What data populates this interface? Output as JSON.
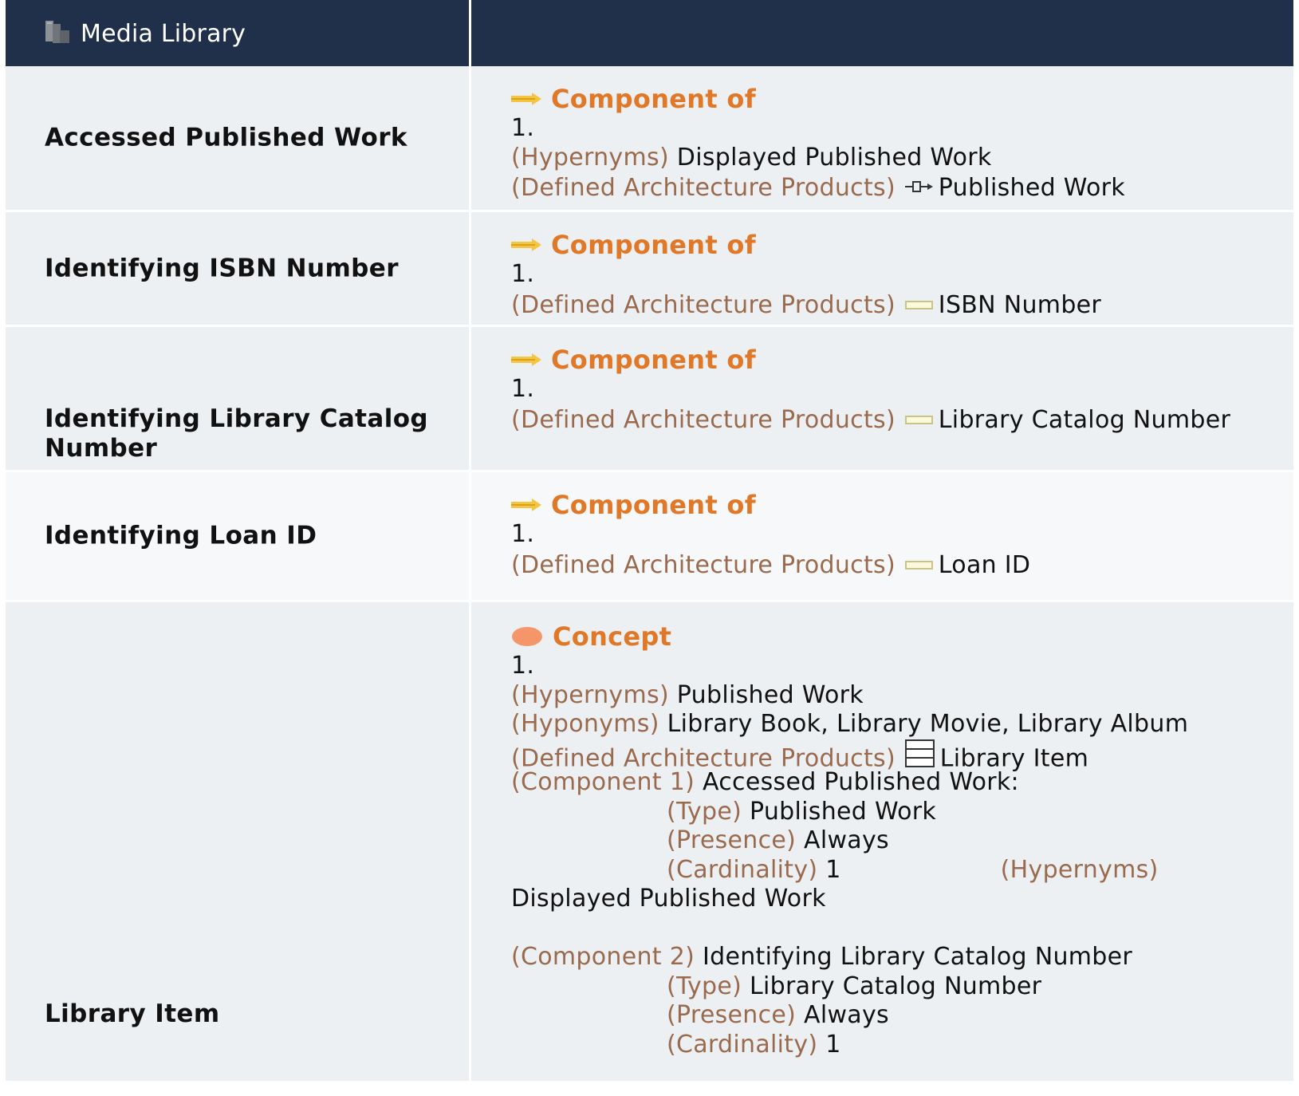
{
  "header": {
    "title": "Media Library",
    "icon": "books-icon"
  },
  "colors": {
    "header_bg": "#21304a",
    "kind_text": "#e07828",
    "label_text": "#9a6a4e",
    "arrow": "#f5c542",
    "concept": "#f4956a"
  },
  "rows": [
    {
      "term": "Accessed Published Work",
      "kind": "Component of",
      "num": "1.",
      "hypernyms_label": "(Hypernyms)",
      "hypernyms": "Displayed Published Work",
      "dap_label": "(Defined Architecture Products)",
      "dap_value": "Published Work"
    },
    {
      "term": "Identifying ISBN Number",
      "kind": "Component of",
      "num": "1.",
      "dap_label": "(Defined Architecture Products)",
      "dap_value": "ISBN Number"
    },
    {
      "term": "Identifying Library Catalog Number",
      "kind": "Component of",
      "num": "1.",
      "dap_label": "(Defined Architecture Products)",
      "dap_value": "Library Catalog Number"
    },
    {
      "term": "Identifying Loan ID",
      "kind": "Component of",
      "num": "1.",
      "dap_label": "(Defined Architecture Products)",
      "dap_value": "Loan ID"
    },
    {
      "term": "Library Item",
      "kind": "Concept",
      "num": "1.",
      "hypernyms_label": "(Hypernyms)",
      "hypernyms": "Published Work",
      "hyponyms_label": "(Hyponyms)",
      "hyponyms": "Library Book, Library Movie, Library Album",
      "dap_label": "(Defined Architecture Products)",
      "dap_value": "Library Item",
      "components": [
        {
          "label": "(Component 1)",
          "name": "Accessed Published Work:",
          "type_label": "(Type)",
          "type": "Published Work",
          "presence_label": "(Presence)",
          "presence": "Always",
          "cardinality_label": "(Cardinality)",
          "cardinality": "1",
          "hypernyms_label": "(Hypernyms)",
          "hypernyms": "Displayed Published Work"
        },
        {
          "label": "(Component 2)",
          "name": "Identifying Library Catalog Number",
          "type_label": "(Type)",
          "type": "Library Catalog Number",
          "presence_label": "(Presence)",
          "presence": "Always",
          "cardinality_label": "(Cardinality)",
          "cardinality": "1"
        }
      ]
    }
  ]
}
